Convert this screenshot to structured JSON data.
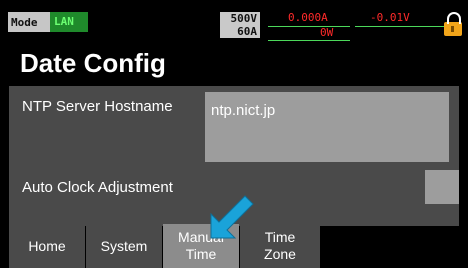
{
  "header": {
    "mode_label": "Mode",
    "mode_value": "LAN",
    "rating_voltage": "500V",
    "rating_current": "60A",
    "current_reading": "0.000A",
    "voltage_reading": "-0.01V",
    "power_reading": "0W",
    "lock_icon": "lock-icon"
  },
  "page": {
    "title": "Date Config"
  },
  "settings": {
    "ntp_label": "NTP Server Hostname",
    "ntp_value": "ntp.nict.jp",
    "auto_clock_label": "Auto Clock Adjustment"
  },
  "tabs": {
    "home": "Home",
    "system": "System",
    "manual_line1": "Manual",
    "manual_line2": "Time",
    "timezone_line1": "Time",
    "timezone_line2": "Zone"
  },
  "annotation": {
    "arrow_icon": "pointer-arrow-icon",
    "arrow_color": "#1aa3d9"
  },
  "colors": {
    "mode_active": "#1f8a2b",
    "lock": "#f2a51a",
    "readout": "#ff2a2a",
    "active_tab": "#8c8c8c"
  }
}
